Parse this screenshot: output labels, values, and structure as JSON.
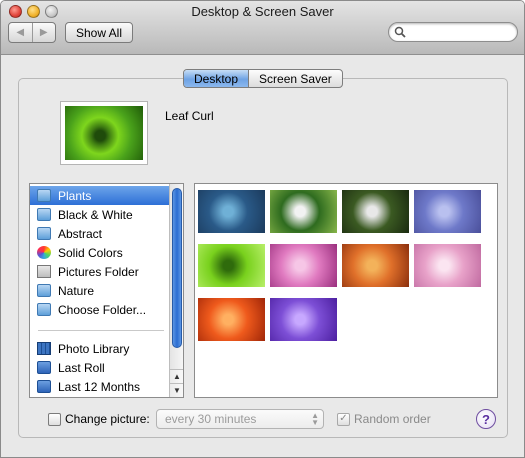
{
  "window": {
    "title": "Desktop & Screen Saver",
    "show_all_label": "Show All",
    "search": {
      "placeholder": "",
      "value": ""
    }
  },
  "tabs": [
    {
      "label": "Desktop",
      "selected": true
    },
    {
      "label": "Screen Saver",
      "selected": false
    }
  ],
  "preview": {
    "name": "Leaf Curl"
  },
  "sidebar": {
    "items": [
      {
        "label": "Plants",
        "icon": "folder-icon",
        "selected": true
      },
      {
        "label": "Black & White",
        "icon": "folder-icon",
        "selected": false
      },
      {
        "label": "Abstract",
        "icon": "folder-icon",
        "selected": false
      },
      {
        "label": "Solid Colors",
        "icon": "color-wheel-icon",
        "selected": false
      },
      {
        "label": "Pictures Folder",
        "icon": "pictures-folder-icon",
        "selected": false
      },
      {
        "label": "Nature",
        "icon": "folder-icon",
        "selected": false
      },
      {
        "label": "Choose Folder...",
        "icon": "folder-icon",
        "selected": false
      }
    ],
    "library_items": [
      {
        "label": "Photo Library",
        "icon": "photo-library-icon"
      },
      {
        "label": "Last Roll",
        "icon": "photo-roll-icon"
      },
      {
        "label": "Last 12 Months",
        "icon": "photo-roll-icon"
      }
    ]
  },
  "thumbnails": [
    {
      "name": "agave",
      "colors": [
        "#2a5a88",
        "#6fb0d6",
        "#1b3a5c"
      ]
    },
    {
      "name": "daisies",
      "colors": [
        "#2e6b1f",
        "#f2f2f2",
        "#88b64a"
      ]
    },
    {
      "name": "dandelion",
      "colors": [
        "#3b5a22",
        "#e8e8e8",
        "#1a2a10"
      ]
    },
    {
      "name": "lavender-petals",
      "colors": [
        "#6e79c9",
        "#b9c0ef",
        "#4a4f9a"
      ]
    },
    {
      "name": "leaf-curl",
      "colors": [
        "#79d11d",
        "#2f6b0c",
        "#b8ef6a"
      ]
    },
    {
      "name": "pink-lotus",
      "colors": [
        "#e07ac0",
        "#f6c6e6",
        "#9a2f7e"
      ]
    },
    {
      "name": "autumn-leaves",
      "colors": [
        "#e0702a",
        "#f3b25a",
        "#8b2f0d"
      ]
    },
    {
      "name": "pink-blossom",
      "colors": [
        "#e8a2c9",
        "#fbe5f1",
        "#c06aa0"
      ]
    },
    {
      "name": "orange-rose",
      "colors": [
        "#ef5a1c",
        "#ffb061",
        "#a02608"
      ]
    },
    {
      "name": "purple-flower",
      "colors": [
        "#7d4fd6",
        "#c7a8ff",
        "#4c1fa0"
      ]
    }
  ],
  "options": {
    "change_picture_label": "Change picture:",
    "change_picture_checked": false,
    "interval_value": "every 30 minutes",
    "random_order_label": "Random order",
    "random_order_checked": true,
    "help_label": "?"
  },
  "colors": {
    "selection": "#2d6fd6",
    "tab_active": "#6fa3e4",
    "help": "#5a2fa0"
  }
}
